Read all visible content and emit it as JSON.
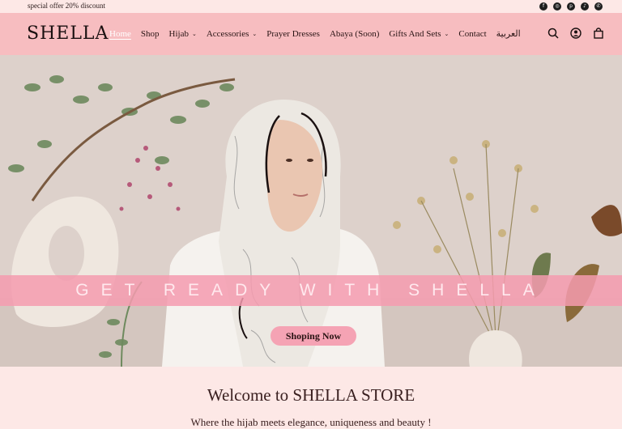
{
  "announcement": {
    "offer_text": "special offer 20% discount",
    "socials": [
      {
        "icon": "facebook-icon",
        "glyph": "f"
      },
      {
        "icon": "instagram-icon",
        "glyph": "◎"
      },
      {
        "icon": "pinterest-icon",
        "glyph": "p"
      },
      {
        "icon": "tiktok-icon",
        "glyph": "♪"
      },
      {
        "icon": "whatsapp-icon",
        "glyph": "✆"
      }
    ]
  },
  "header": {
    "logo": "SHELLA",
    "nav": [
      {
        "label": "Home",
        "active": true,
        "dropdown": false
      },
      {
        "label": "Shop",
        "active": false,
        "dropdown": false
      },
      {
        "label": "Hijab",
        "active": false,
        "dropdown": true
      },
      {
        "label": "Accessories",
        "active": false,
        "dropdown": true
      },
      {
        "label": "Prayer Dresses",
        "active": false,
        "dropdown": false
      },
      {
        "label": "Abaya (Soon)",
        "active": false,
        "dropdown": false
      },
      {
        "label": "Gifts And Sets",
        "active": false,
        "dropdown": true
      },
      {
        "label": "Contact",
        "active": false,
        "dropdown": false
      },
      {
        "label": "العربية",
        "active": false,
        "dropdown": false
      }
    ],
    "icons": [
      "search-icon",
      "account-icon",
      "cart-icon"
    ]
  },
  "hero": {
    "tagline": "GET READY WITH SHELLA",
    "button_label": "Shoping Now"
  },
  "intro": {
    "title": "Welcome to SHELLA STORE",
    "subtitle": "Where the hijab meets elegance, uniqueness and beauty !"
  },
  "colors": {
    "header_bg": "#f7bdc0",
    "page_bg": "#fde8e6",
    "band": "#f59baf",
    "button": "#f5a3b4"
  }
}
